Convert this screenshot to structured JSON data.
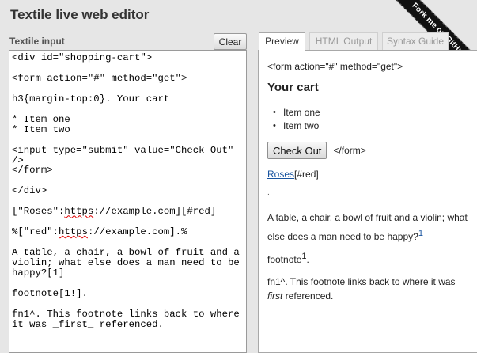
{
  "header": {
    "title": "Textile live web editor"
  },
  "ribbon": {
    "label": "Fork me on GitHub"
  },
  "left_panel": {
    "label": "Textile input",
    "clear_label": "Clear",
    "lines": [
      "<div id=\"shopping-cart\">",
      "",
      "<form action=\"#\" method=\"get\">",
      "",
      "h3{margin-top:0}. Your cart",
      "",
      "* Item one",
      "* Item two",
      "",
      "<input type=\"submit\" value=\"Check Out\"",
      "/>",
      "</form>",
      "",
      "</div>",
      "",
      "[\"Roses\":https://example.com][#red]",
      "",
      "%[\"red\":https://example.com].%",
      "",
      "A table, a chair, a bowl of fruit and a",
      "violin; what else does a man need to be",
      "happy?[1]",
      "",
      "footnote[1!].",
      "",
      "fn1^. This footnote links back to where",
      "it was _first_ referenced."
    ]
  },
  "tabs": [
    {
      "label": "Preview",
      "active": true
    },
    {
      "label": "HTML Output",
      "active": false
    },
    {
      "label": "Syntax Guide",
      "active": false
    }
  ],
  "preview": {
    "form_open": "<form action=\"#\" method=\"get\">",
    "heading": "Your cart",
    "items": [
      "Item one",
      "Item two"
    ],
    "checkout_label": "Check Out",
    "form_close": "</form>",
    "roses_link": "Roses",
    "roses_suffix": "[#red]",
    "dot": ".",
    "para_text": "A table, a chair, a bowl of fruit and a violin; what else does a man need to be happy?",
    "para_ref": "1",
    "footref_text": "footnote",
    "footref_sup": "1",
    "footnote_prefix": "fn1^. This footnote links back to where it was ",
    "footnote_em": "first",
    "footnote_suffix": " referenced."
  },
  "colors": {
    "background": "#e6e6e6",
    "link": "#1a55a0",
    "ribbon": "#111111"
  }
}
